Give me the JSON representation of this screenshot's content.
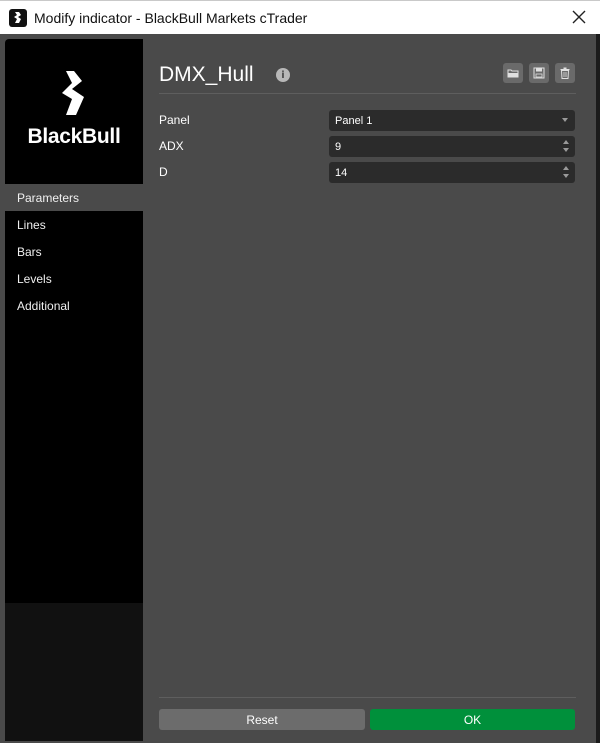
{
  "window": {
    "title": "Modify indicator - BlackBull Markets cTrader"
  },
  "sidebar": {
    "logo_text": "BlackBull",
    "items": [
      {
        "label": "Parameters",
        "active": true
      },
      {
        "label": "Lines",
        "active": false
      },
      {
        "label": "Bars",
        "active": false
      },
      {
        "label": "Levels",
        "active": false
      },
      {
        "label": "Additional",
        "active": false
      }
    ]
  },
  "header": {
    "title": "DMX_Hull",
    "info_icon": "info-icon",
    "tools": [
      "open-folder-icon",
      "save-icon",
      "trash-icon"
    ]
  },
  "params": [
    {
      "label": "Panel",
      "value": "Panel 1",
      "type": "select"
    },
    {
      "label": "ADX",
      "value": "9",
      "type": "number"
    },
    {
      "label": "D",
      "value": "14",
      "type": "number"
    }
  ],
  "footer": {
    "reset_label": "Reset",
    "ok_label": "OK"
  },
  "colors": {
    "ok_button": "#00903b",
    "background": "#4a4a4a",
    "sidebar": "#000000"
  }
}
